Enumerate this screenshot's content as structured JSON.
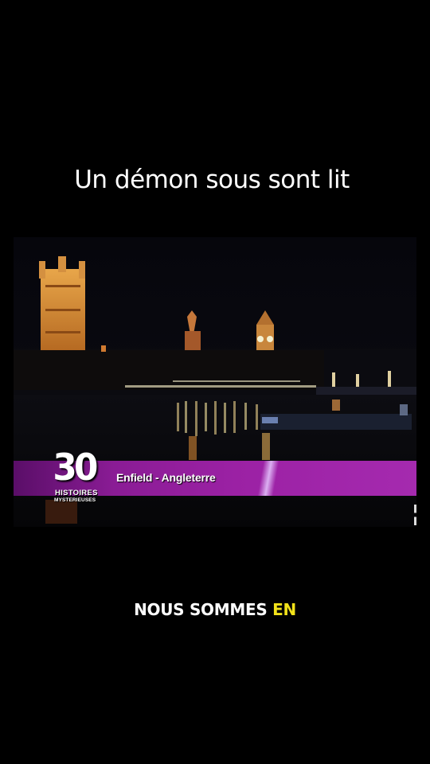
{
  "caption": {
    "title": "Un démon sous sont lit"
  },
  "video": {
    "scene": "night-view-westminster-thames",
    "banner": {
      "logo_number": "30",
      "logo_line1": "HISTOIRES",
      "logo_line2": "MYSTERIEUSES",
      "location": "Enfield - Angleterre",
      "color": "#9b21a4"
    }
  },
  "subtitle": {
    "part1": "NOUS SOMMES ",
    "part2": "EN",
    "highlight_color": "#f2e21a"
  }
}
